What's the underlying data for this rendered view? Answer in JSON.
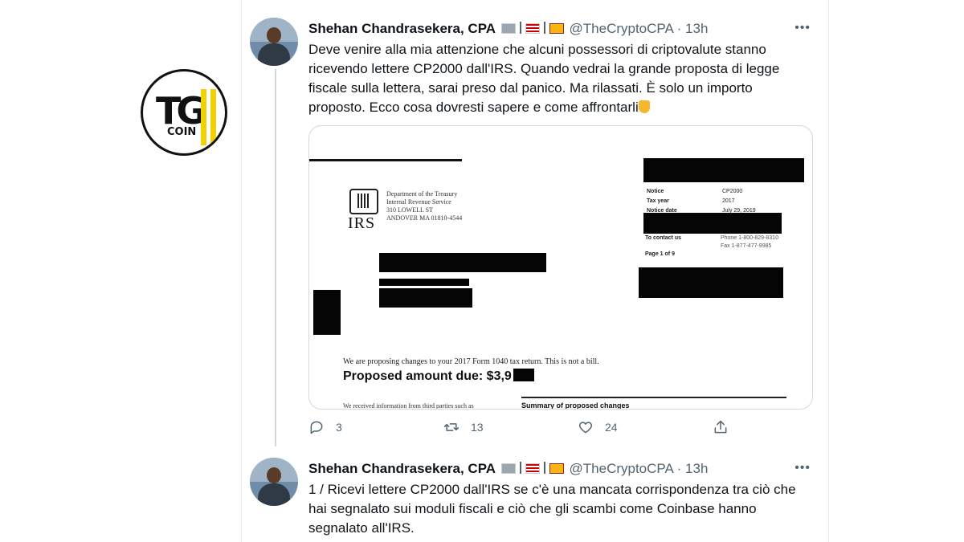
{
  "watermark": {
    "logo_text": "TG",
    "logo_subtext": "COIN"
  },
  "tweets": [
    {
      "name": "Shehan Chandrasekera, CPA",
      "handle": "@TheCryptoCPA",
      "time": "13h",
      "text": "Deve venire alla mia attenzione che alcuni possessori di criptovalute stanno ricevendo lettere CP2000 dall'IRS. Quando vedrai la grande proposta di legge fiscale sulla lettera, sarai preso dal panico. Ma rilassati. È solo un importo proposto. Ecco cosa dovresti sapere e come affrontarli",
      "actions": {
        "replies": "3",
        "retweets": "13",
        "likes": "24"
      }
    },
    {
      "name": "Shehan Chandrasekera, CPA",
      "handle": "@TheCryptoCPA",
      "time": "13h",
      "text": "1 / Ricevi lettere CP2000 dall'IRS se c'è una mancata corrispondenza tra ciò che hai segnalato sui moduli fiscali e ciò che gli scambi come Coinbase hanno segnalato all'IRS."
    }
  ],
  "document": {
    "irs": "IRS",
    "dept_lines": [
      "Department of the Treasury",
      "Internal Revenue Service",
      "310 LOWELL ST",
      "ANDOVER MA 01810-4544"
    ],
    "notice": [
      {
        "label": "Notice",
        "value": "CP2000"
      },
      {
        "label": "Tax year",
        "value": "2017"
      },
      {
        "label": "Notice date",
        "value": "July 29, 2019"
      }
    ],
    "contact_label": "To contact us",
    "contact_phone": "Phone 1-800-829-8310",
    "contact_fax": "Fax 1-877-477-9985",
    "page": "Page 1 of 9",
    "proposing": "We are proposing changes to your 2017 Form 1040 tax return.  This is not a bill.",
    "amount": "Proposed amount due: $3,9",
    "received": "We received information from third parties such as",
    "summary": "Summary of proposed changes"
  },
  "colors": {
    "text": "#0f1419",
    "muted": "#536471",
    "border": "#cfd9de",
    "logo_yellow": "#f2d100"
  }
}
